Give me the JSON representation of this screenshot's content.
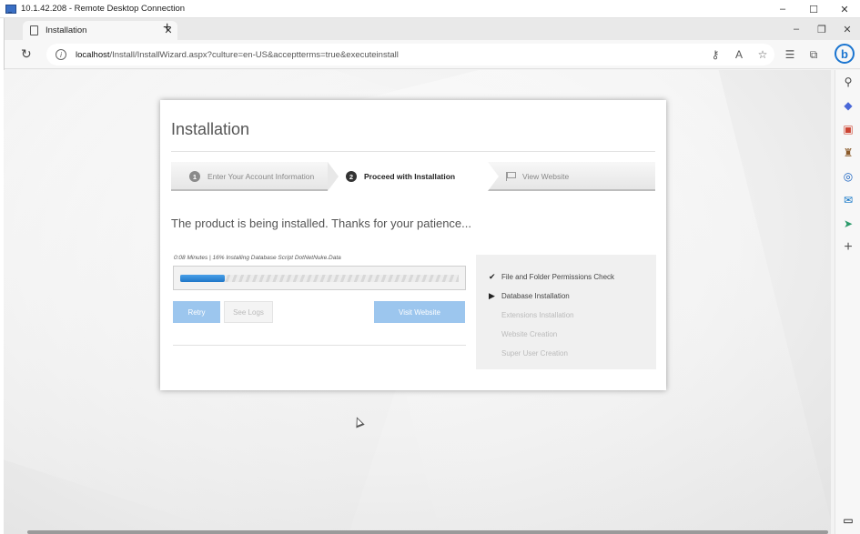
{
  "rdp": {
    "title": "10.1.42.208 - Remote Desktop Connection",
    "controls": {
      "minimize": "–",
      "maximize": "☐",
      "close": "✕"
    }
  },
  "browser": {
    "tab_title": "Installation",
    "tab_close": "✕",
    "new_tab": "+",
    "controls": {
      "minimize": "–",
      "restore": "❐",
      "close": "✕"
    },
    "reload": "↻",
    "info": "i",
    "url_host": "localhost",
    "url_path": "/Install/InstallWizard.aspx?culture=en-US&acceptterms=true&executeinstall",
    "icons": {
      "read_aloud": "A",
      "favorite": "☆",
      "favorites": "☰",
      "collections": "⧉",
      "more": "···",
      "bing": "b"
    }
  },
  "sidebar": {
    "search": "⚲",
    "tag": "◆",
    "briefcase": "▣",
    "chess": "♜",
    "office": "◎",
    "outlook": "✉",
    "send": "➤",
    "add": "+",
    "bottom": "▭"
  },
  "installer": {
    "title": "Installation",
    "steps": [
      {
        "num": "1",
        "label": "Enter Your Account Information"
      },
      {
        "num": "2",
        "label": "Proceed with Installation"
      },
      {
        "label": "View Website"
      }
    ],
    "message": "The product is being installed. Thanks for your patience...",
    "progress_text": "0:08 Minutes  |  16% Installing Database Script DotNetNuke.Data",
    "progress_fraction": 0.16,
    "buttons": {
      "retry": "Retry",
      "see_logs": "See Logs",
      "visit_website": "Visit Website"
    },
    "checklist": [
      {
        "mark": "✔",
        "label": "File and Folder Permissions Check",
        "state": "done"
      },
      {
        "mark": "▶",
        "label": "Database Installation",
        "state": "current"
      },
      {
        "mark": "",
        "label": "Extensions Installation",
        "state": "pending"
      },
      {
        "mark": "",
        "label": "Website Creation",
        "state": "pending"
      },
      {
        "mark": "",
        "label": "Super User Creation",
        "state": "pending"
      }
    ]
  }
}
